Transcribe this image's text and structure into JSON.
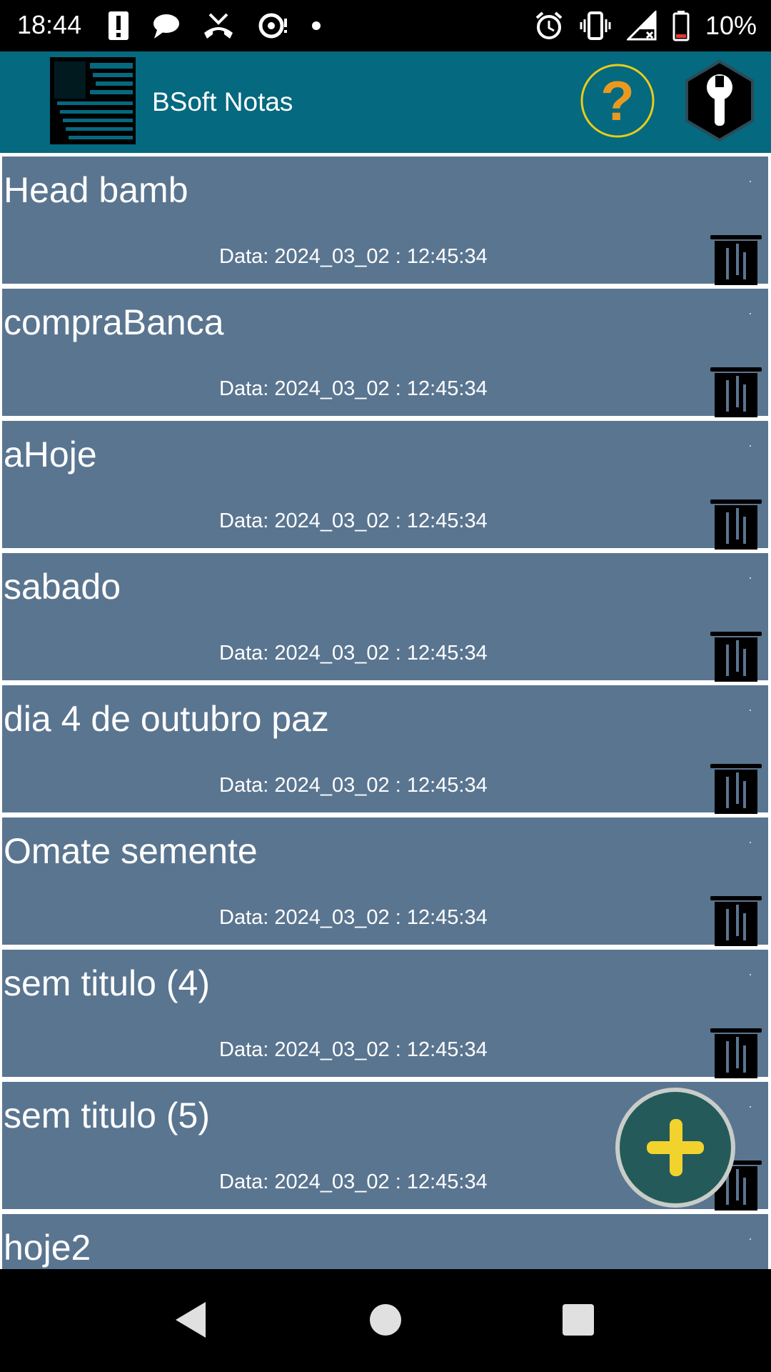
{
  "status_bar": {
    "time": "18:44",
    "battery_percent": "10%",
    "left_icons": [
      "alert-icon",
      "chat-icon",
      "missed-call-icon",
      "sync-icon",
      "dot-icon"
    ],
    "right_icons": [
      "alarm-icon",
      "vibrate-icon",
      "signal-icon",
      "battery-icon"
    ]
  },
  "app_bar": {
    "title": "BSoft Notas",
    "accent_help": "#e8cc1a",
    "help_glyph": "?"
  },
  "notes": [
    {
      "title": "Head bamb",
      "date": "Data: 2024_03_02 : 12:45:34"
    },
    {
      "title": "compraBanca",
      "date": "Data: 2024_03_02 : 12:45:34"
    },
    {
      "title": "aHoje",
      "date": "Data: 2024_03_02 : 12:45:34"
    },
    {
      "title": "sabado",
      "date": "Data: 2024_03_02 : 12:45:34"
    },
    {
      "title": "dia 4 de outubro paz",
      "date": "Data: 2024_03_02 : 12:45:34"
    },
    {
      "title": "Omate semente",
      "date": "Data: 2024_03_02 : 12:45:34"
    },
    {
      "title": "sem titulo (4)",
      "date": "Data: 2024_03_02 : 12:45:34"
    },
    {
      "title": "sem titulo (5)",
      "date": "Data: 2024_03_02 : 12:45:34"
    },
    {
      "title": "hoje2",
      "date": ""
    }
  ],
  "colors": {
    "app_bar": "#05697f",
    "card": "#5a7590",
    "fab": "#245b5a",
    "fab_plus": "#f2d32e"
  }
}
